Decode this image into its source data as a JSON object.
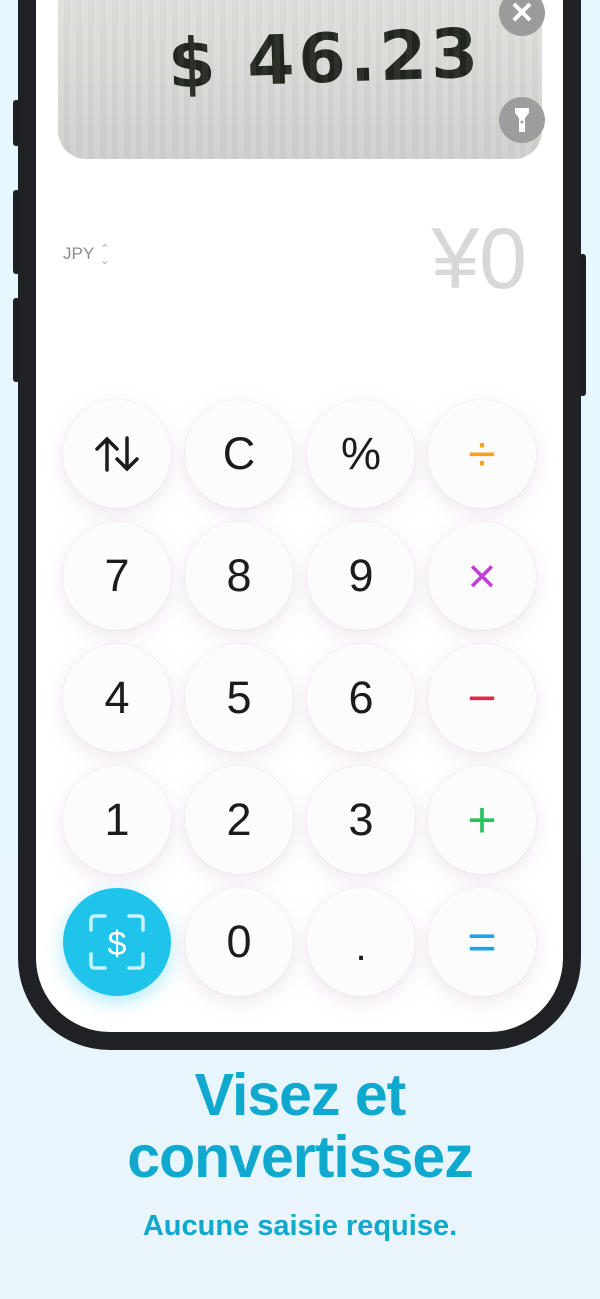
{
  "camera": {
    "scanned_text": "$ 46.23"
  },
  "icons": {
    "close": "close-icon",
    "torch": "flashlight-icon"
  },
  "display": {
    "currency_code": "JPY",
    "amount": "¥0"
  },
  "keys": {
    "swap": "↑↓",
    "clear": "C",
    "percent": "%",
    "divide": "÷",
    "seven": "7",
    "eight": "8",
    "nine": "9",
    "multiply": "×",
    "four": "4",
    "five": "5",
    "six": "6",
    "minus": "−",
    "one": "1",
    "two": "2",
    "three": "3",
    "plus": "+",
    "scan": "$",
    "zero": "0",
    "dot": ".",
    "equals": "="
  },
  "colors": {
    "divide": "#f5a023",
    "multiply": "#c43dd8",
    "minus": "#e8244c",
    "plus": "#27c25c",
    "equals": "#1aa3ef",
    "scan_bg": "#1ec4ea",
    "headline": "#0fa9cf"
  },
  "marketing": {
    "headline_line1": "Visez et",
    "headline_line2": "convertissez",
    "subline": "Aucune saisie requise."
  }
}
